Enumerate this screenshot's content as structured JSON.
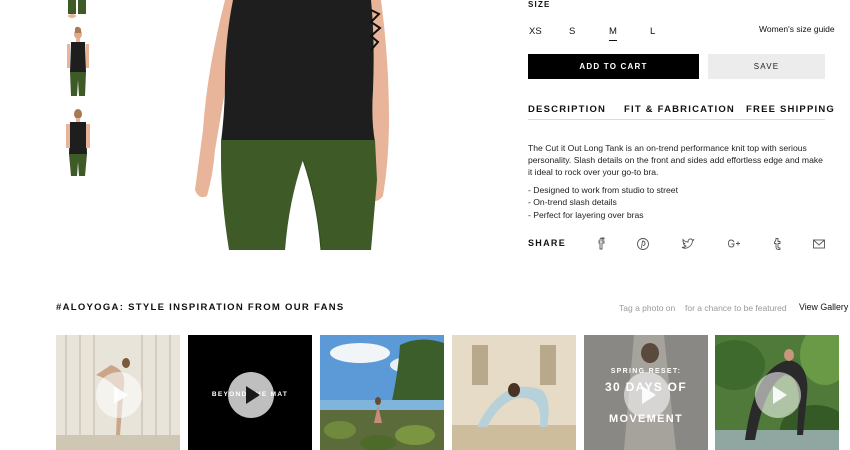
{
  "product": {
    "size_label": "SIZE",
    "sizes": [
      "XS",
      "S",
      "M",
      "L"
    ],
    "selected_size": "M",
    "size_guide_label": "Women's size guide",
    "add_to_cart_label": "ADD TO CART",
    "save_label": "SAVE",
    "tabs": [
      "DESCRIPTION",
      "FIT & FABRICATION",
      "FREE SHIPPING"
    ],
    "description": "The Cut it Out Long Tank is an on-trend performance knit top with serious personality. Slash details on the front and sides add effortless edge and make it ideal to rock over your go-to bra.",
    "bullets": [
      "- Designed to work from studio to street",
      "- On-trend slash details",
      "- Perfect for layering over bras"
    ],
    "share_label": "SHARE",
    "share_icons": [
      "facebook-icon",
      "pinterest-icon",
      "twitter-icon",
      "google-plus-icon",
      "tumblr-icon",
      "email-icon"
    ]
  },
  "inspiration": {
    "title": "#ALOYOGA: STYLE INSPIRATION FROM OUR FANS",
    "tag_note": "Tag a photo on",
    "featured_note": "for a chance to be featured",
    "view_gallery_label": "View Gallery",
    "tiles": [
      {
        "caption": "",
        "video": true
      },
      {
        "caption": "BEYOND THE MAT",
        "video": true
      },
      {
        "caption": "",
        "video": false
      },
      {
        "caption": "",
        "video": false
      },
      {
        "caption_top": "SPRING RESET:",
        "caption_main": "30 DAYS OF",
        "caption_bottom": "MOVEMENT",
        "video": true
      },
      {
        "caption": "",
        "video": true
      }
    ]
  },
  "colors": {
    "tank": "#1e1e1e",
    "leggings": "#3e5a26",
    "skin": "#e8b49a",
    "button_dark": "#000000",
    "button_light": "#ececec"
  }
}
